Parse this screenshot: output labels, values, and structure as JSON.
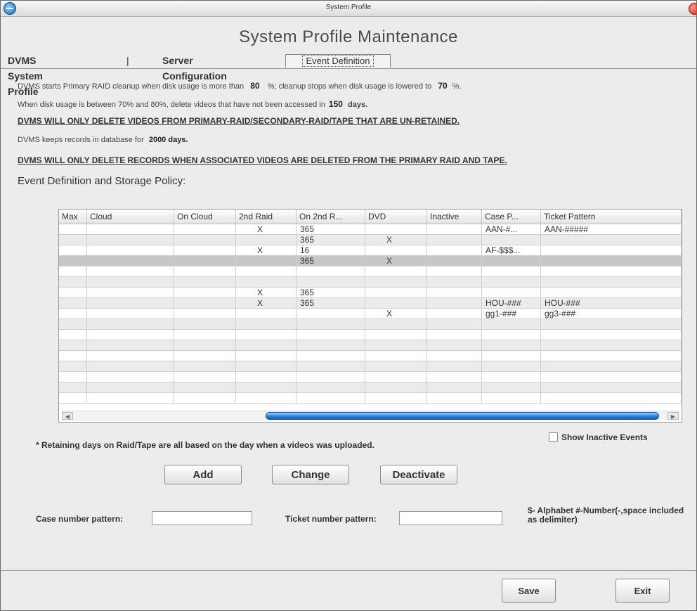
{
  "window": {
    "title": "System Profile"
  },
  "header": {
    "main_title": "System Profile Maintenance"
  },
  "tabs": [
    {
      "label": "DVMS System Profile"
    },
    {
      "label": "|"
    },
    {
      "label": "Server Configuration"
    },
    {
      "label": "Event Definition"
    }
  ],
  "policy": {
    "line1_a": "DVMS starts Primary RAID cleanup when disk usage is more than",
    "line1_val1": "80",
    "line1_b": "%;  cleanup stops when disk usage is lowered to",
    "line1_val2": "70",
    "line1_c": "%.",
    "line2_a": "When disk usage is between   70% and 80%,      delete videos that have not been accessed in",
    "line2_val": "150",
    "line2_b": "days.",
    "warning1": "DVMS WILL ONLY DELETE VIDEOS FROM PRIMARY-RAID/SECONDARY-RAID/TAPE THAT ARE UN-RETAINED.",
    "line3_a": "DVMS keeps records in database for",
    "line3_val": "2000 days.",
    "warning2": "DVMS WILL ONLY DELETE RECORDS WHEN ASSOCIATED VIDEOS ARE DELETED FROM THE PRIMARY RAID AND TAPE."
  },
  "section": {
    "title": "Event Definition and Storage Policy:"
  },
  "grid": {
    "columns": [
      "Max",
      "Cloud",
      "On Cloud",
      "2nd Raid",
      "On 2nd R...",
      "DVD",
      "Inactive",
      "Case P...",
      "Ticket Pattern"
    ],
    "rows": [
      [
        "",
        "",
        "",
        "X",
        "365",
        "",
        "",
        "AAN-#...",
        "AAN-#####"
      ],
      [
        "",
        "",
        "",
        "",
        "365",
        "X",
        "",
        "",
        ""
      ],
      [
        "",
        "",
        "",
        "X",
        "16",
        "",
        "",
        "AF-$$$...",
        ""
      ],
      [
        "",
        "",
        "",
        "",
        "365",
        "X",
        "",
        "",
        ""
      ],
      [
        "",
        "",
        "",
        "",
        "",
        "",
        "",
        "",
        ""
      ],
      [
        "",
        "",
        "",
        "",
        "",
        "",
        "",
        "",
        ""
      ],
      [
        "",
        "",
        "",
        "X",
        "365",
        "",
        "",
        "",
        ""
      ],
      [
        "",
        "",
        "",
        "X",
        "365",
        "",
        "",
        "HOU-###",
        "HOU-###"
      ],
      [
        "",
        "",
        "",
        "",
        "",
        "X",
        "",
        "gg1-###",
        "gg3-###"
      ],
      [
        "",
        "",
        "",
        "",
        "",
        "",
        "",
        "",
        ""
      ],
      [
        "",
        "",
        "",
        "",
        "",
        "",
        "",
        "",
        ""
      ],
      [
        "",
        "",
        "",
        "",
        "",
        "",
        "",
        "",
        ""
      ],
      [
        "",
        "",
        "",
        "",
        "",
        "",
        "",
        "",
        ""
      ],
      [
        "",
        "",
        "",
        "",
        "",
        "",
        "",
        "",
        ""
      ],
      [
        "",
        "",
        "",
        "",
        "",
        "",
        "",
        "",
        ""
      ],
      [
        "",
        "",
        "",
        "",
        "",
        "",
        "",
        "",
        ""
      ],
      [
        "",
        "",
        "",
        "",
        "",
        "",
        "",
        "",
        ""
      ]
    ],
    "selected_row": 3
  },
  "note": "* Retaining days on Raid/Tape are all based on the day when a videos was uploaded.",
  "show_inactive": {
    "label": "Show Inactive Events",
    "checked": false
  },
  "buttons": {
    "add": "Add",
    "change": "Change",
    "deactivate": "Deactivate",
    "save": "Save",
    "exit": "Exit"
  },
  "form": {
    "case_label": "Case number pattern:",
    "case_value": "",
    "ticket_label": "Ticket number pattern:",
    "ticket_value": "",
    "hint": "$- Alphabet #-Number(-,space included as delimiter)"
  },
  "icons": {
    "app": "globe-icon",
    "close": "close-icon",
    "scroll_left": "chevron-left-icon",
    "scroll_right": "chevron-right-icon"
  }
}
